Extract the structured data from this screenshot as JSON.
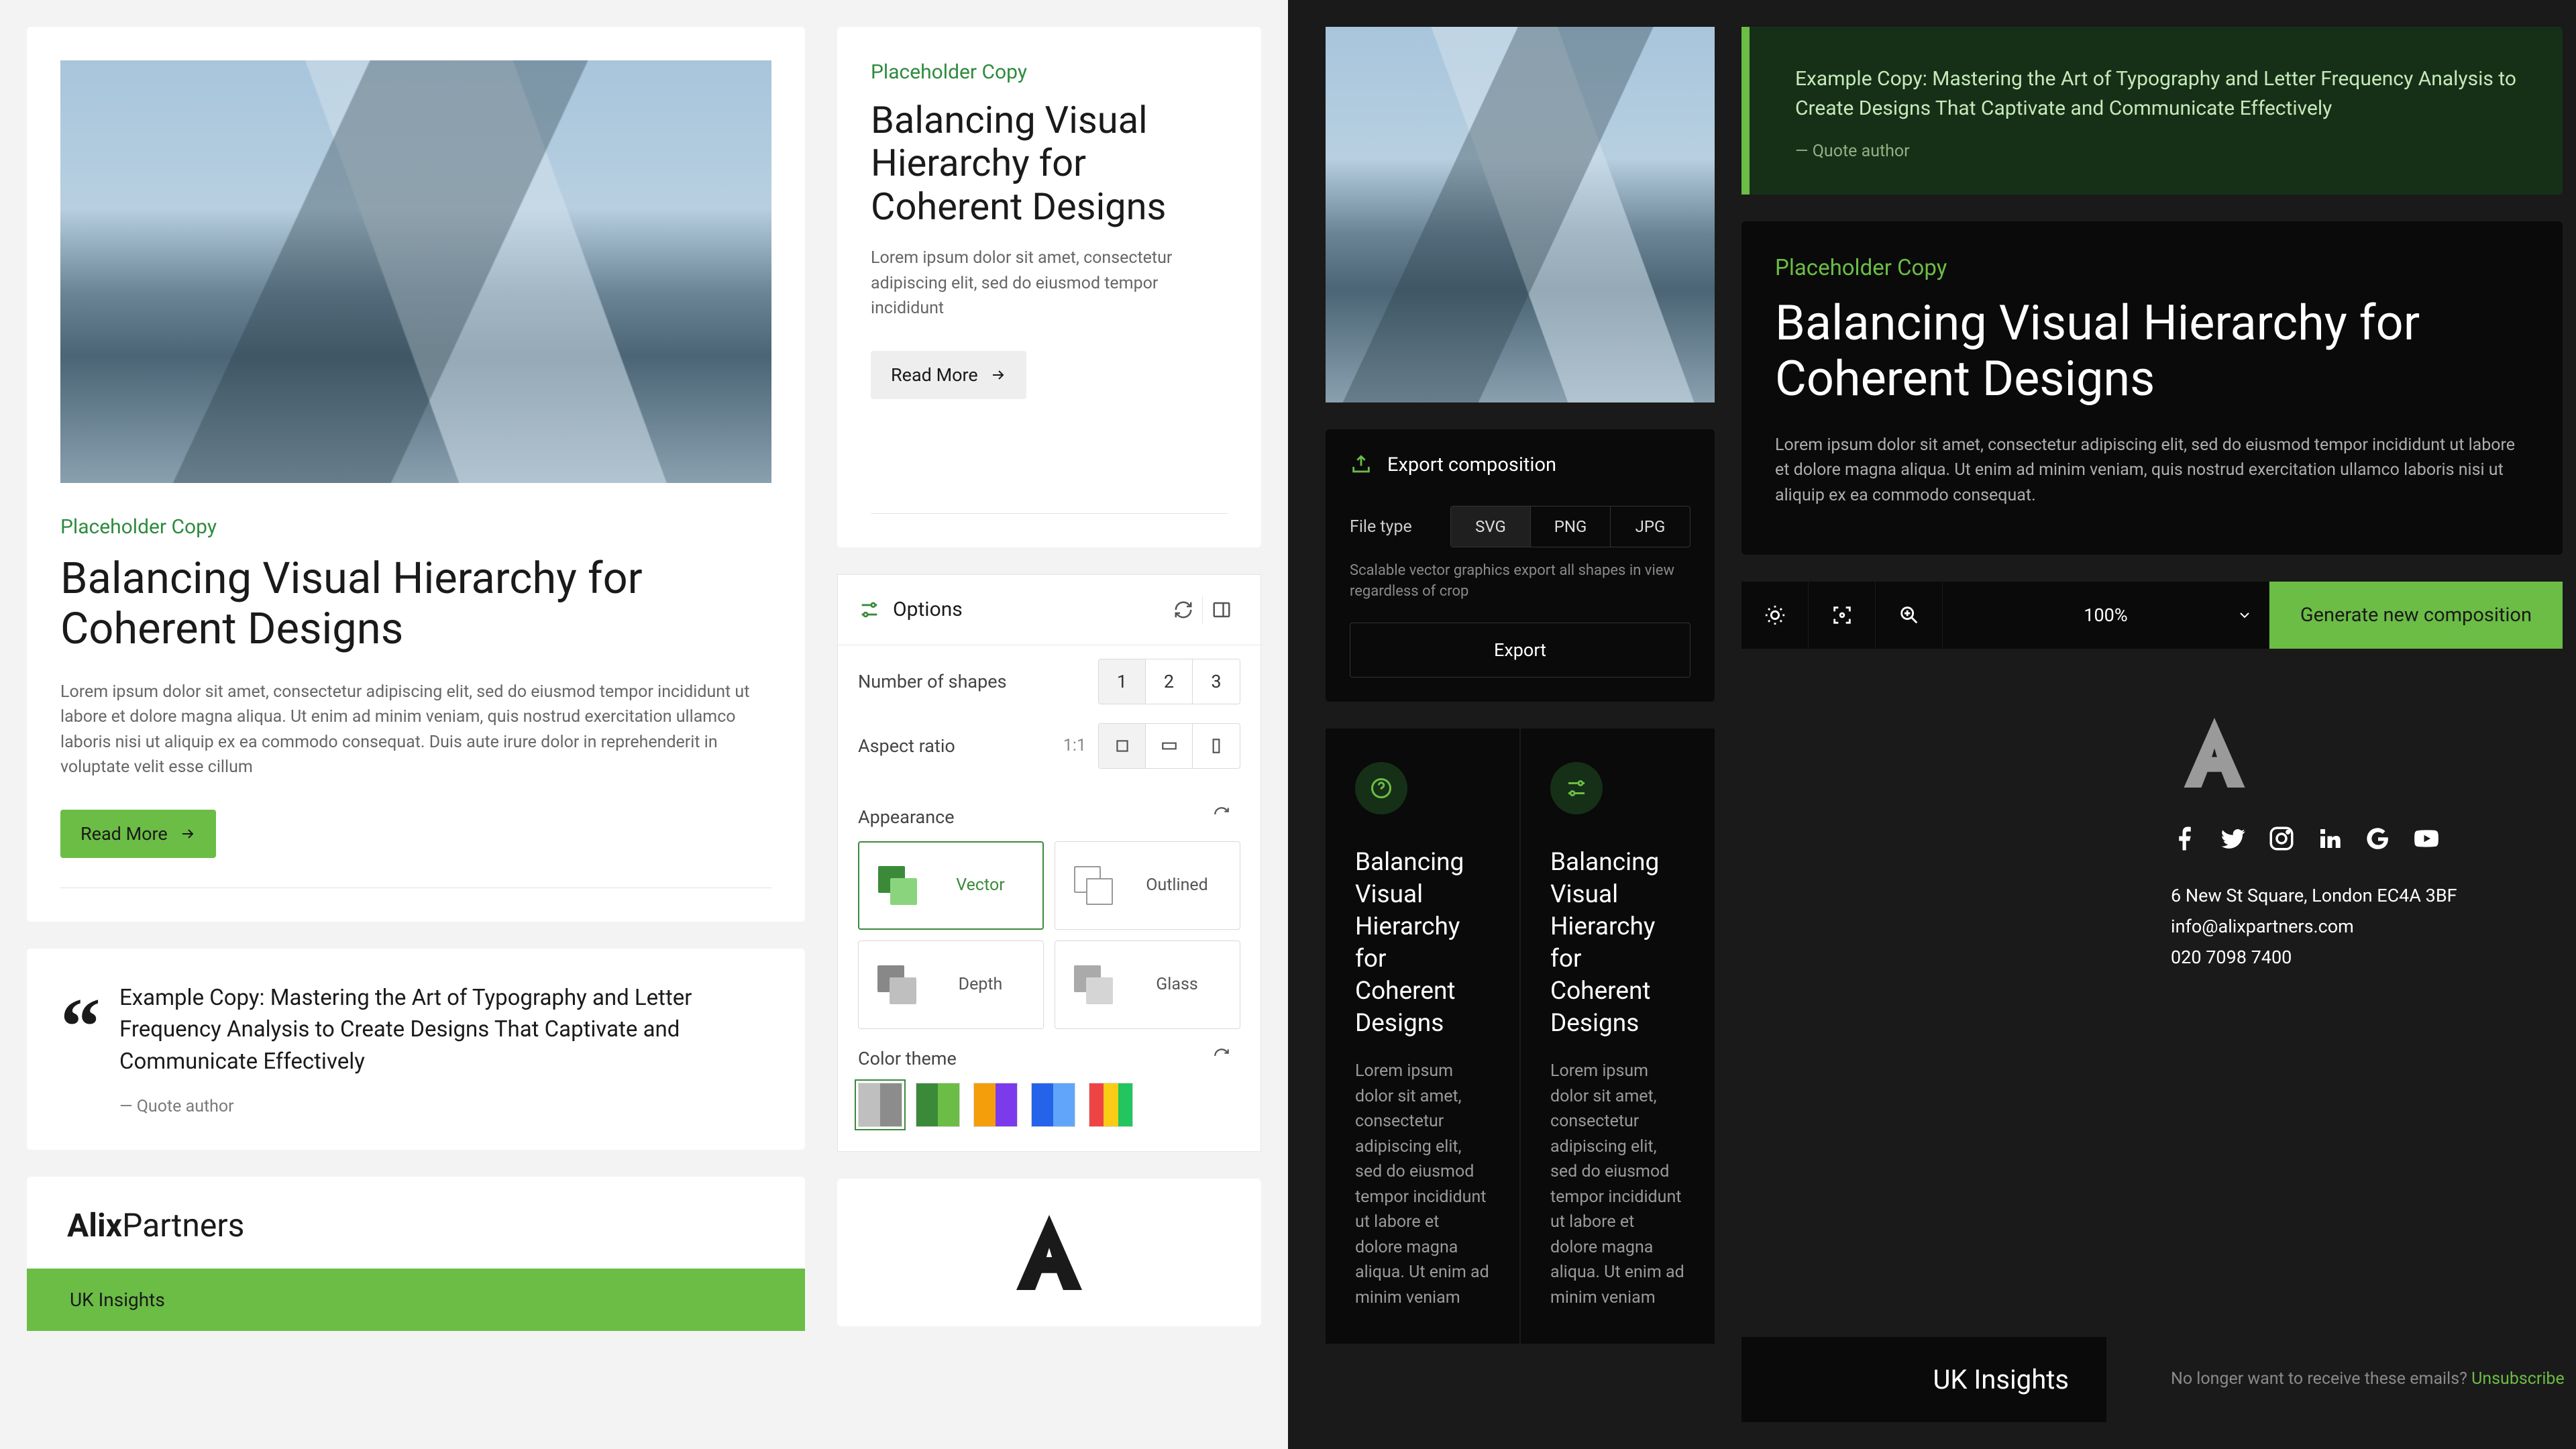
{
  "light": {
    "article": {
      "eyebrow": "Placeholder Copy",
      "title": "Balancing Visual Hierarchy for Coherent Designs",
      "body": "Lorem ipsum dolor sit amet, consectetur adipiscing elit, sed do eiusmod tempor incididunt ut labore et dolore magna aliqua. Ut enim ad minim veniam, quis nostrud exercitation ullamco laboris nisi ut aliquip ex ea commodo consequat. Duis aute irure dolor in reprehenderit in voluptate velit esse cillum",
      "cta": "Read More"
    },
    "quote": {
      "text": "Example Copy: Mastering the Art of Typography and Letter Frequency Analysis to Create Designs That Captivate and Communicate Effectively",
      "author": "— Quote author"
    },
    "brand": {
      "name_bold": "Alix",
      "name_rest": "Partners",
      "tab": "UK Insights"
    },
    "article_sm": {
      "eyebrow": "Placeholder Copy",
      "title": "Balancing Visual Hierarchy for Coherent Designs",
      "body": "Lorem ipsum dolor sit amet, consectetur adipiscing elit, sed do eiusmod tempor incididunt",
      "cta": "Read More"
    },
    "options": {
      "title": "Options",
      "num_shapes": {
        "label": "Number of shapes",
        "choices": [
          "1",
          "2",
          "3"
        ],
        "selected": "1"
      },
      "aspect": {
        "label": "Aspect ratio",
        "value": "1:1",
        "selected": 0
      },
      "appearance": {
        "label": "Appearance",
        "choices": [
          "Vector",
          "Outlined",
          "Depth",
          "Glass"
        ],
        "selected": "Vector"
      },
      "theme": {
        "label": "Color theme"
      }
    }
  },
  "dark": {
    "export": {
      "title": "Export composition",
      "filetype_label": "File type",
      "filetypes": [
        "SVG",
        "PNG",
        "JPG"
      ],
      "selected": "SVG",
      "hint": "Scalable vector graphics export all shapes in view regardless of crop",
      "button": "Export"
    },
    "quote": {
      "text": "Example Copy: Mastering the Art of Typography and Letter Frequency Analysis to Create Designs That Captivate and Communicate Effectively",
      "author": "— Quote author"
    },
    "article": {
      "eyebrow": "Placeholder Copy",
      "title": "Balancing Visual Hierarchy for Coherent Designs",
      "body": "Lorem ipsum dolor sit amet, consectetur adipiscing elit, sed do eiusmod tempor incididunt ut labore et dolore magna aliqua. Ut enim ad minim veniam, quis nostrud exercitation ullamco laboris nisi ut aliquip ex ea commodo consequat."
    },
    "toolbar": {
      "zoom": "100%",
      "generate": "Generate new composition"
    },
    "cards": {
      "a": {
        "title": "Balancing Visual Hierarchy for Coherent Designs",
        "body": "Lorem ipsum dolor sit amet, consectetur adipiscing elit, sed do eiusmod tempor incididunt ut labore et dolore magna aliqua. Ut enim ad minim veniam"
      },
      "b": {
        "title": "Balancing Visual Hierarchy for Coherent Designs",
        "body": "Lorem ipsum dolor sit amet, consectetur adipiscing elit, sed do eiusmod tempor incididunt ut labore et dolore magna aliqua. Ut enim ad minim veniam"
      }
    },
    "uk_row": "UK Insights",
    "footer": {
      "address": "6 New St Square, London EC4A 3BF",
      "email": "info@alixpartners.com",
      "phone": "020 7098 7400",
      "unsub_prefix": "No longer want to receive these emails? ",
      "unsub_link": "Unsubscribe"
    }
  }
}
